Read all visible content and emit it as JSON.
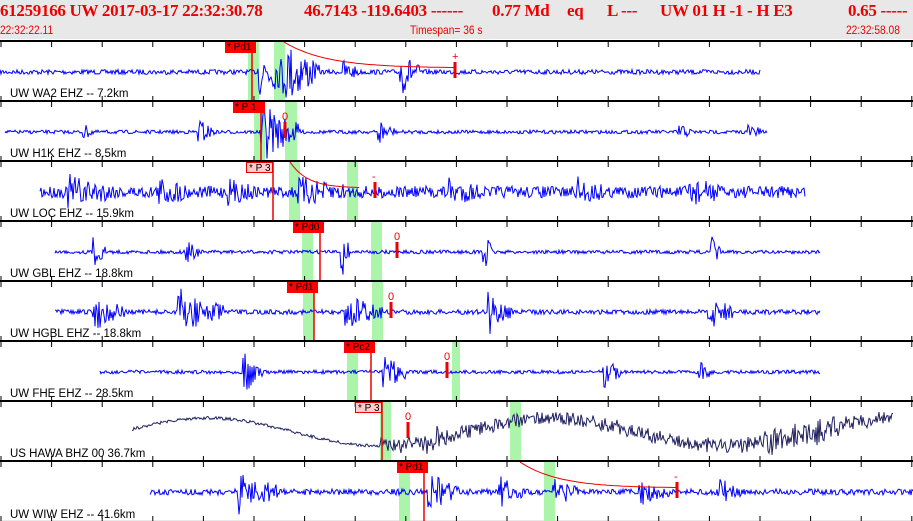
{
  "header": {
    "event_id": "61259166 UW 2017-03-17 22:32:30.78",
    "location": "46.7143 -119.6403 ------",
    "magnitude": "0.77 Md",
    "event_type": "eq",
    "flag": "L ---",
    "network_info": "UW 01  H  -1  -  H E3",
    "quality": "0.65 -----",
    "start_time": "22:32:22.11",
    "timespan": "Timespan=  36 s",
    "end_time": "22:32:58.08"
  },
  "colors": {
    "trace": "#0000ff",
    "trace_broadband": "#202060",
    "pick": "#ff0000",
    "window": "#aaf5aa"
  },
  "panels": [
    {
      "label": "UW WA2 EHZ -- 7.2km",
      "pick": "* Pd1",
      "marker": "+"
    },
    {
      "label": "UW H1K EHZ -- 8.5km",
      "pick": "* P 1",
      "marker": "0"
    },
    {
      "label": "UW LOC EHZ -- 15.9km",
      "pick": "* P 3",
      "marker": "-"
    },
    {
      "label": "UW GBL EHZ -- 18.8km",
      "pick": "* Pd0",
      "marker": "0"
    },
    {
      "label": "UW HGBL EHZ -- 18.8km",
      "pick": "* Pd1",
      "marker": "0"
    },
    {
      "label": "UW FHE EHZ -- 28.5km",
      "pick": "* Pc2",
      "marker": "0"
    },
    {
      "label": "US HAWA BHZ 00 36.7km",
      "pick": "* P 3",
      "marker": "0"
    },
    {
      "label": "UW WIW EHZ -- 41.6km",
      "pick": "* Pd1",
      "marker": "-"
    }
  ]
}
